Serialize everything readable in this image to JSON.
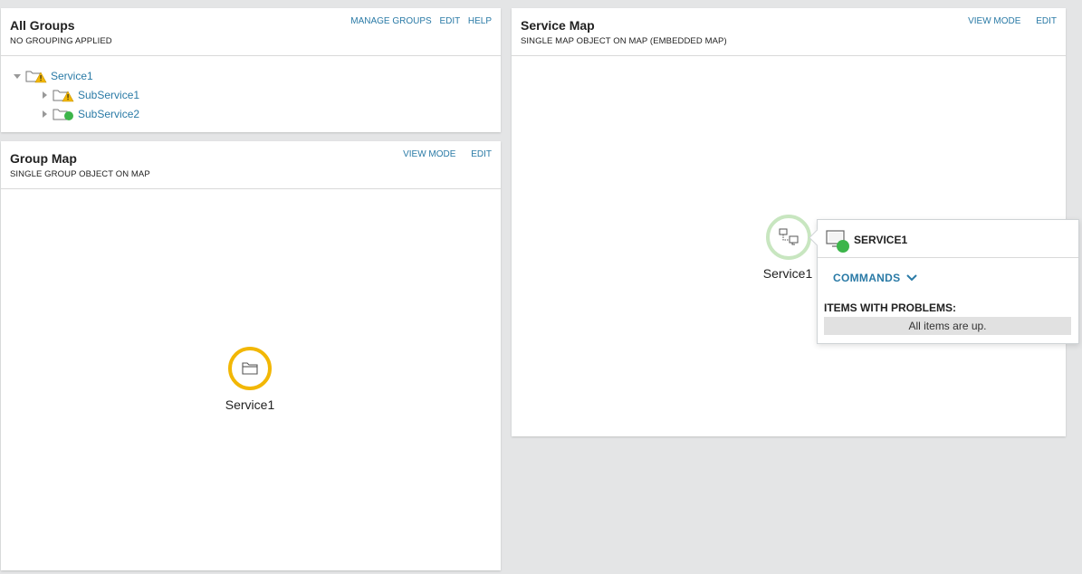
{
  "all_groups": {
    "title": "All Groups",
    "subtitle": "NO GROUPING APPLIED",
    "links": {
      "manage_groups": "MANAGE GROUPS",
      "edit": "EDIT",
      "help": "HELP"
    },
    "tree": [
      {
        "label": "Service1",
        "status": "warning",
        "expanded": true
      },
      {
        "label": "SubService1",
        "status": "warning",
        "expanded": false
      },
      {
        "label": "SubService2",
        "status": "up",
        "expanded": false
      }
    ]
  },
  "group_map": {
    "title": "Group Map",
    "subtitle": "SINGLE GROUP OBJECT ON MAP",
    "links": {
      "view_mode": "VIEW MODE",
      "edit": "EDIT"
    },
    "node": {
      "label": "Service1",
      "status": "warning",
      "icon": "folder-icon"
    }
  },
  "service_map": {
    "title": "Service Map",
    "subtitle": "SINGLE MAP OBJECT ON MAP (EMBEDDED MAP)",
    "links": {
      "view_mode": "VIEW MODE",
      "edit": "EDIT"
    },
    "node": {
      "label": "Service1",
      "status": "up",
      "icon": "network-map-icon"
    },
    "popup": {
      "title": "SERVICE1",
      "commands_label": "COMMANDS",
      "problems_title": "ITEMS WITH PROBLEMS:",
      "problems_text": "All items are up."
    }
  },
  "colors": {
    "link": "#2a7aa6",
    "warning": "#f2b705",
    "up": "#3cb54a",
    "up_ring": "#c8e6c0"
  }
}
